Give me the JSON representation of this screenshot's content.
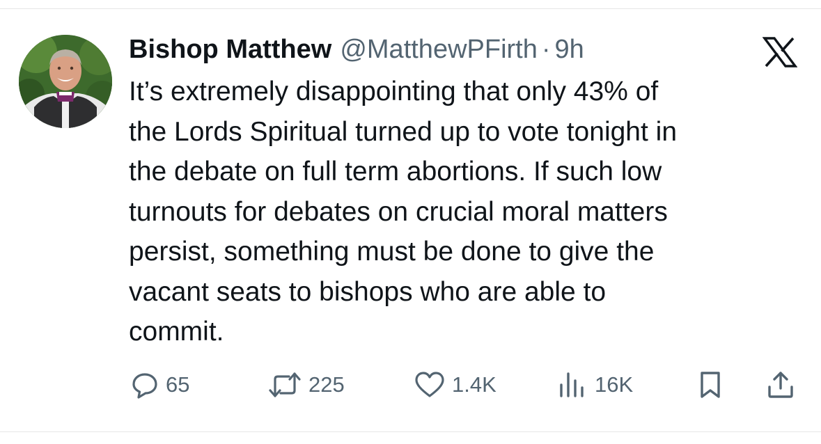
{
  "tweet": {
    "author": {
      "display_name": "Bishop Matthew",
      "handle": "@MatthewPFirth",
      "separator": "·",
      "time": "9h"
    },
    "text": "It’s extremely disappointing that only 43% of\nthe Lords Spiritual turned up to vote tonight in\nthe debate on full term abortions. If such low\nturnouts for debates on crucial moral matters\npersist, something must be done to give the\nvacant seats to bishops who are able to\ncommit.",
    "stats": {
      "replies": "65",
      "retweets": "225",
      "likes": "1.4K",
      "views": "16K"
    },
    "icons": {
      "brand": "x-logo-icon",
      "reply": "reply-icon",
      "retweet": "retweet-icon",
      "like": "heart-icon",
      "views": "views-icon",
      "bookmark": "bookmark-icon",
      "share": "share-icon"
    },
    "colors": {
      "text": "#0f1419",
      "secondary": "#536471",
      "background": "#ffffff"
    }
  }
}
